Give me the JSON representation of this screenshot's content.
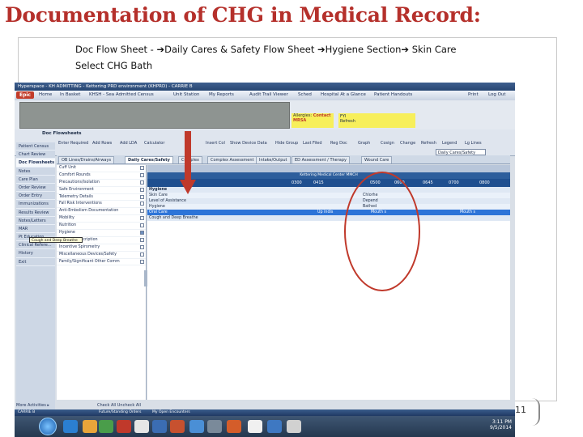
{
  "slide": {
    "title": "Documentation of CHG in Medical Record:",
    "nav_path": "Doc Flow Sheet - ➔Daily Cares & Safety Flow Sheet ➔Hygiene Section➔ Skin Care",
    "nav_line2": "Select  CHG Bath",
    "page_number": "11"
  },
  "epic": {
    "window_title": "Hyperspace - KH ADMITTING - Kettering PRD environment (KHPRD) - CARRIE B",
    "epic_button": "Epic",
    "toolbar": [
      "Home",
      "In Basket",
      "KHSH - Sea Admitted Census",
      "Unit Station",
      "My Reports",
      "Audit Trail Viewer",
      "Sched",
      "Hospital At a Glance",
      "Patient Handouts"
    ],
    "user_buttons": [
      "Print",
      "Log Out"
    ],
    "allergy_label": "Allergies:",
    "allergy_value": "Contact",
    "allergy_extra": "MRSA",
    "fyi_label": "FYI",
    "refresh_label": "Refresh",
    "activity_title": "Doc Flowsheets",
    "activity_buttons": [
      "Enter Required",
      "Add Rows",
      "Add LDA",
      "Calculator",
      "Insert Col",
      "Show Device Data",
      "Hide Group",
      "Last Filed",
      "Reg Doc",
      "Graph",
      "Cosign",
      "Change",
      "Refresh",
      "Legend",
      "Lg Lines"
    ],
    "flowsheet_dropdown": "Daily Cares/Safety",
    "sidebar": [
      "Patient Census",
      "Chart Review",
      "Doc Flowsheets",
      "Notes",
      "Care Plan",
      "Order Review",
      "Order Entry",
      "Immunizations",
      "Results Review",
      "Notes/Letters",
      "MAR",
      "Pt Education",
      "Clinical Refere...",
      "History",
      "Exit"
    ],
    "sidebar_active": "Doc Flowsheets",
    "more_activities": "More Activities ▸",
    "tabs": [
      "OB Lines/Drains/Airways",
      "Daily Cares/Safety",
      "Complex",
      "Complex Assessment",
      "Intake/Output",
      "ED Assessment / Therapy",
      "Wound Care"
    ],
    "active_tab": "Daily Cares/Safety",
    "groups": [
      {
        "label": "Cuff Unit",
        "checked": false
      },
      {
        "label": "Comfort Rounds",
        "checked": false
      },
      {
        "label": "Precautions/Isolation",
        "checked": false
      },
      {
        "label": "Safe Environment",
        "checked": false
      },
      {
        "label": "Telemetry Details",
        "checked": false
      },
      {
        "label": "Fall Risk Interventions",
        "checked": false
      },
      {
        "label": "Anti-Embolism Documentation",
        "checked": false
      },
      {
        "label": "Mobility",
        "checked": false
      },
      {
        "label": "Nutrition",
        "checked": false
      },
      {
        "label": "Hygiene",
        "checked": true
      },
      {
        "label": "Sputum Description",
        "checked": false
      },
      {
        "label": "Incentive Spirometry",
        "checked": false
      },
      {
        "label": "Miscellaneous Devices/Safety",
        "checked": false
      },
      {
        "label": "Family/Significant Other Comm",
        "checked": false
      }
    ],
    "group_buttons": [
      "Check All",
      "Uncheck All"
    ],
    "grid_facility": "Kettering Medical Center MMCH",
    "times": [
      "0300",
      "0415",
      "0500",
      "0600",
      "0645",
      "0700",
      "0800"
    ],
    "rows": [
      "Hygiene",
      "Skin Care",
      "Level of Assistance",
      "Hygiene",
      "Oral Care",
      "Cough and Deep Breathe"
    ],
    "cells": {
      "skin_care": "Chlorhe",
      "level": "Depend",
      "hygiene": "Bathed",
      "oral_left": "Up indis",
      "oral_mid": "Mouth s",
      "oral_right": "Mouth s"
    },
    "popup_text": "Cough and Deep Breathe",
    "status_bar": "CARRIE B",
    "status_items": [
      "Future/Standing Orders",
      "My Open Encounters"
    ],
    "clock_time": "3:11 PM",
    "clock_date": "9/5/2014"
  },
  "colors": {
    "title": "#b5302b",
    "annotation": "#c0392b",
    "epic_header": "#274672",
    "selected_row": "#2d74d8"
  }
}
